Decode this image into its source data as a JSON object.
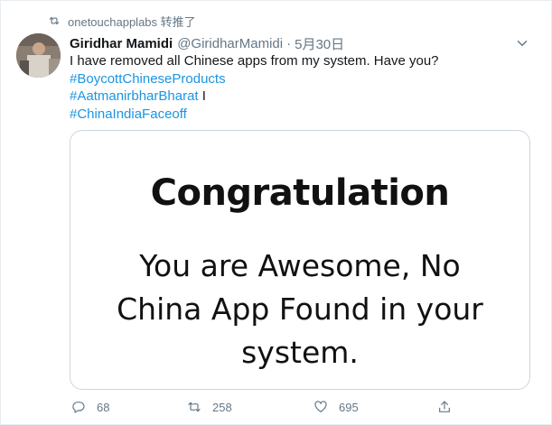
{
  "retweet": {
    "icon": "retweet-icon",
    "text": "onetouchapplabs 转推了"
  },
  "tweet": {
    "author_name": "Giridhar Mamidi",
    "author_handle": "@GiridharMamidi",
    "separator": "·",
    "date": "5月30日",
    "text_line_1": "I have removed all Chinese apps from my system. Have you?",
    "hashtag_1": "#BoycottChineseProducts",
    "hashtag_2": "#AatmanirbharBharat",
    "hashtag_2_suffix": " I",
    "hashtag_3": "#ChinaIndiaFaceoff"
  },
  "card": {
    "heading": "Congratulation",
    "body_line_1": "You are Awesome, No",
    "body_line_2": "China App Found in your",
    "body_line_3": "system."
  },
  "actions": {
    "reply_count": "68",
    "retweet_count": "258",
    "like_count": "695"
  },
  "colors": {
    "link": "#1b95e0",
    "secondary_text": "#657786",
    "border": "#ccd6dd"
  }
}
